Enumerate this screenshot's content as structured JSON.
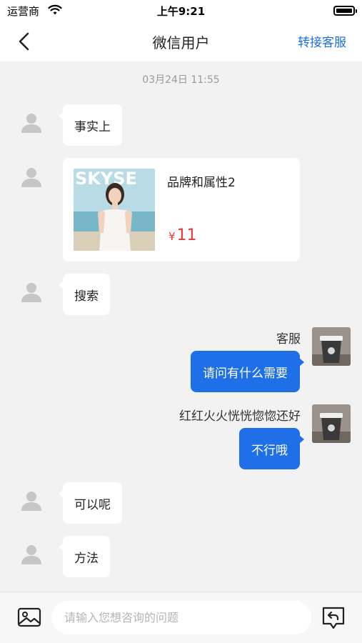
{
  "status_bar": {
    "carrier": "运营商",
    "time": "上午9:21"
  },
  "nav": {
    "title": "微信用户",
    "transfer_label": "转接客服"
  },
  "timestamp": "03月24日 11:55",
  "messages": {
    "m1": {
      "text": "事实上"
    },
    "product": {
      "name": "品牌和属性2",
      "price_symbol": "¥",
      "price": "11",
      "image_text": "SKYSE"
    },
    "m3": {
      "text": "搜索"
    },
    "m4": {
      "sender": "客服",
      "text": "请问有什么需要"
    },
    "m5": {
      "sender": "红红火火恍恍惚惚还好",
      "text": "不行哦"
    },
    "m6": {
      "text": "可以呢"
    },
    "m7": {
      "text": "方法"
    }
  },
  "input_bar": {
    "placeholder": "请输入您想咨询的问题"
  },
  "colors": {
    "accent": "#1e6fe0",
    "bubble_self": "#1e6fe8",
    "price": "#e53935",
    "background": "#f2f2f2"
  },
  "icons": [
    "wifi-icon",
    "battery-icon",
    "back-arrow-icon",
    "default-avatar-icon",
    "image-icon",
    "reply-icon"
  ]
}
